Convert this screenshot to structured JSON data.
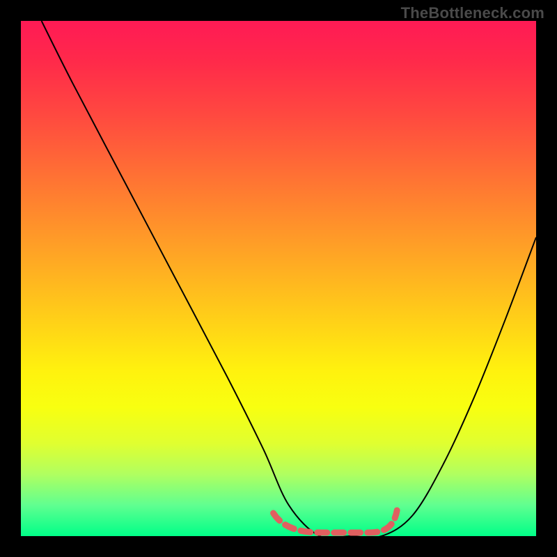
{
  "watermark": "TheBottleneck.com",
  "chart_data": {
    "type": "line",
    "title": "",
    "xlabel": "",
    "ylabel": "",
    "xlim": [
      0,
      100
    ],
    "ylim": [
      0,
      100
    ],
    "grid": false,
    "series": [
      {
        "name": "curve",
        "x": [
          4,
          10,
          20,
          30,
          40,
          47,
          52,
          58,
          64,
          70,
          76,
          82,
          88,
          94,
          100
        ],
        "y": [
          100,
          88,
          69,
          50,
          31,
          17,
          6,
          0,
          0,
          0,
          4,
          14,
          27,
          42,
          58
        ]
      }
    ],
    "annotations": [
      {
        "name": "valley-highlight",
        "style": "dashed-pink",
        "x_range": [
          49,
          73
        ],
        "y": 0
      }
    ],
    "colors": {
      "top": "#ff1a55",
      "mid": "#ffe010",
      "bottom": "#00ff88",
      "curve": "#000000",
      "highlight": "#e06060"
    }
  }
}
